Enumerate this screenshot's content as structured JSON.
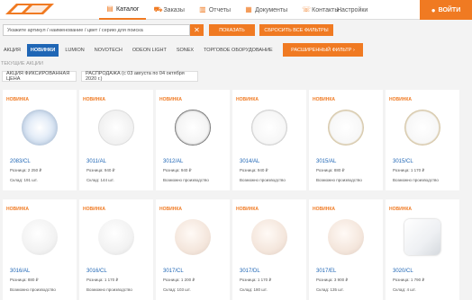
{
  "header": {
    "nav": [
      {
        "label": "Каталог",
        "icon": "catalog-icon",
        "active": true
      },
      {
        "label": "Заказы",
        "icon": "cart-icon"
      },
      {
        "label": "Отчеты",
        "icon": "report-icon"
      },
      {
        "label": "Документы",
        "icon": "document-icon"
      },
      {
        "label": "Контакты",
        "icon": "phone-icon"
      }
    ],
    "settings_label": "Настройки",
    "login_label": "ВОЙТИ"
  },
  "search": {
    "placeholder": "Укажите артикул / наименование / цвет / серию для поиска",
    "show_label": "ПОКАЗАТЬ",
    "reset_label": "СБРОСИТЬ ВСЕ ФИЛЬТРЫ"
  },
  "brands": [
    "АКЦИЯ",
    "НОВИНКИ",
    "LUMION",
    "NOVOTECH",
    "ODEON LIGHT",
    "SONEX",
    "ТОРГОВОЕ ОБОРУДОВАНИЕ"
  ],
  "active_brand": "НОВИНКИ",
  "extended_filter_label": "РАСШИРЕННЫЙ ФИЛЬТР ›",
  "promo": {
    "label": "ТЕКУЩИЕ АКЦИИ",
    "items": [
      "АКЦИЯ ФИКСИРОВАННАЯ ЦЕНА",
      "РАСПРОДАЖА (с 03 августа по 04 октября 2020 г.)"
    ]
  },
  "accent_color": "#f07a22",
  "brand_color": "#1f66b5",
  "products": [
    {
      "badge": "НОВИНКА",
      "code": "2083/CL",
      "price": "Розница: 2 250 ₽",
      "stock": "Склад: 191 шт.",
      "style": "crystal"
    },
    {
      "badge": "НОВИНКА",
      "code": "3011/AL",
      "price": "Розница: 940 ₽",
      "stock": "Склад: 144 шт.",
      "style": "pattern"
    },
    {
      "badge": "НОВИНКА",
      "code": "3012/AL",
      "price": "Розница: 940 ₽",
      "stock": "Возможно производство",
      "style": "dark-ring"
    },
    {
      "badge": "НОВИНКА",
      "code": "3014/AL",
      "price": "Розница: 940 ₽",
      "stock": "Возможно производство",
      "style": "silver-ring"
    },
    {
      "badge": "НОВИНКА",
      "code": "3015/AL",
      "price": "Розница: 880 ₽",
      "stock": "Возможно производство",
      "style": "gold-ring"
    },
    {
      "badge": "НОВИНКА",
      "code": "3015/CL",
      "price": "Розница: 1 170 ₽",
      "stock": "Возможно производство",
      "style": "gold-ring"
    },
    {
      "badge": "НОВИНКА",
      "code": "3016/AL",
      "price": "Розница: 880 ₽",
      "stock": "Возможно производство",
      "style": "white"
    },
    {
      "badge": "НОВИНКА",
      "code": "3016/CL",
      "price": "Розница: 1 170 ₽",
      "stock": "Возможно производство",
      "style": "white"
    },
    {
      "badge": "НОВИНКА",
      "code": "3017/CL",
      "price": "Розница: 1 200 ₽",
      "stock": "Склад: 103 шт.",
      "style": "warm"
    },
    {
      "badge": "НОВИНКА",
      "code": "3017/DL",
      "price": "Розница: 1 170 ₽",
      "stock": "Склад: 180 шт.",
      "style": "warm"
    },
    {
      "badge": "НОВИНКА",
      "code": "3017/EL",
      "price": "Розница: 3 900 ₽",
      "stock": "Склад: 135 шт.",
      "style": "warm"
    },
    {
      "badge": "НОВИНКА",
      "code": "3020/CL",
      "price": "Розница: 1 790 ₽",
      "stock": "Склад: 4 шт.",
      "style": "square"
    }
  ]
}
